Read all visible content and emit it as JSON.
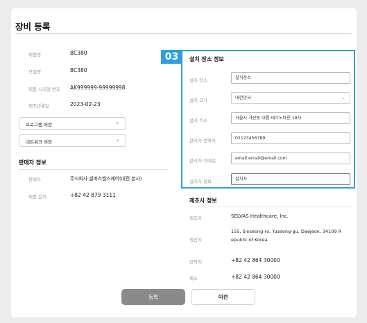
{
  "page": {
    "title": "장비 등록"
  },
  "device": {
    "product_name_label": "제품명",
    "product_name": "BC380",
    "model_name_label": "모델명",
    "model_name": "BC380",
    "serial_label": "제품 시리얼 번호",
    "serial": "AK999999-99999998",
    "mfg_date_label": "제조년월일",
    "mfg_date": "2023-02-23",
    "program_version_label": "프로그램 버전",
    "network_version_label": "네트워크 버전",
    "chevron": "›"
  },
  "seller": {
    "section_title": "판매자 정보",
    "seller_label": "판매자",
    "seller": "주식회사 셀바스헬스케어(대전 본사)",
    "inquiry_label": "제품 문의",
    "inquiry": "+82 42 879 3111"
  },
  "install": {
    "badge": "03",
    "section_title": "설치 장소 정보",
    "place_label": "설치 장소",
    "place_value": "설치장소",
    "country_label": "설치 국가",
    "country_value": "대한민국",
    "address_label": "설치 주소",
    "address_value": "서울시 가산동 대륭 테크노타운 18차",
    "manager_phone_label": "관리자 연락처",
    "manager_phone_value": "02123456789",
    "manager_email_label": "관리자 이메일",
    "manager_email_value": "email.email@email.com",
    "installer_label": "설치자 정보",
    "installer_value": "설치자",
    "select_chevron": "⌄"
  },
  "manufacturer": {
    "section_title": "제조사 정보",
    "maker_label": "제조자",
    "maker": "SELVAS Healthcare, Inc.",
    "site_label": "생산지",
    "site_line1": "155, Sinseong-ro, Yuseong-gu, Daejeon, 34109 R",
    "site_line2": "epublic of Korea",
    "phone_label": "연락처",
    "phone": "+82 42 864 30000",
    "fax_label": "팩스",
    "fax": "+82 42 864 30000"
  },
  "actions": {
    "submit_label": "등록",
    "prev_label": "이전"
  },
  "colors": {
    "accent": "#2e9fde",
    "submit_bg": "#8a8a8a"
  }
}
